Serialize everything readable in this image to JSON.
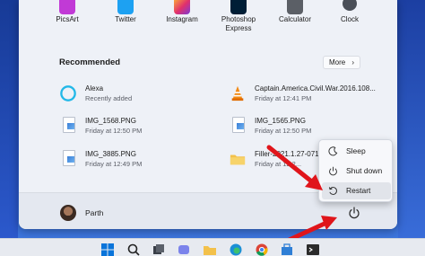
{
  "pinned": [
    {
      "label": "PicsArt",
      "icon": "picsart-icon",
      "color": "#c13ad6"
    },
    {
      "label": "Twitter",
      "icon": "twitter-icon",
      "color": "#1da1f2"
    },
    {
      "label": "Instagram",
      "icon": "instagram-icon",
      "color": "#e1306c"
    },
    {
      "label": "Photoshop\nExpress",
      "label_line1": "Photoshop",
      "label_line2": "Express",
      "icon": "photoshop-express-icon",
      "color": "#001e36"
    },
    {
      "label": "Calculator",
      "icon": "calculator-icon",
      "color": "#5b5f66"
    },
    {
      "label": "Clock",
      "icon": "clock-icon",
      "color": "#4a4f58"
    }
  ],
  "recommended": {
    "title": "Recommended",
    "more_label": "More",
    "items": [
      {
        "name": "Alexa",
        "sub": "Recently added",
        "icon": "alexa-icon"
      },
      {
        "name": "Captain.America.Civil.War.2016.108...",
        "sub": "Friday at 12:41 PM",
        "icon": "vlc-icon"
      },
      {
        "name": "IMG_1568.PNG",
        "sub": "Friday at 12:50 PM",
        "icon": "image-file-icon"
      },
      {
        "name": "IMG_1565.PNG",
        "sub": "Friday at 12:50 PM",
        "icon": "image-file-icon"
      },
      {
        "name": "IMG_3885.PNG",
        "sub": "Friday at 12:49 PM",
        "icon": "image-file-icon"
      },
      {
        "name": "Filler-2021.1.27-0712...",
        "sub": "Friday at 12:2...",
        "icon": "folder-icon"
      }
    ]
  },
  "user": {
    "name": "Parth"
  },
  "power_menu": {
    "items": [
      {
        "label": "Sleep",
        "icon": "sleep-icon"
      },
      {
        "label": "Shut down",
        "icon": "power-icon"
      },
      {
        "label": "Restart",
        "icon": "restart-icon"
      }
    ]
  },
  "taskbar": {
    "icons": [
      "windows-start-icon",
      "search-icon",
      "task-view-icon",
      "teams-chat-icon",
      "file-explorer-icon",
      "edge-icon",
      "chrome-icon",
      "store-icon",
      "settings-icon",
      "terminal-icon"
    ]
  },
  "colors": {
    "accent": "#0067c0",
    "arrow": "#e0151b"
  }
}
